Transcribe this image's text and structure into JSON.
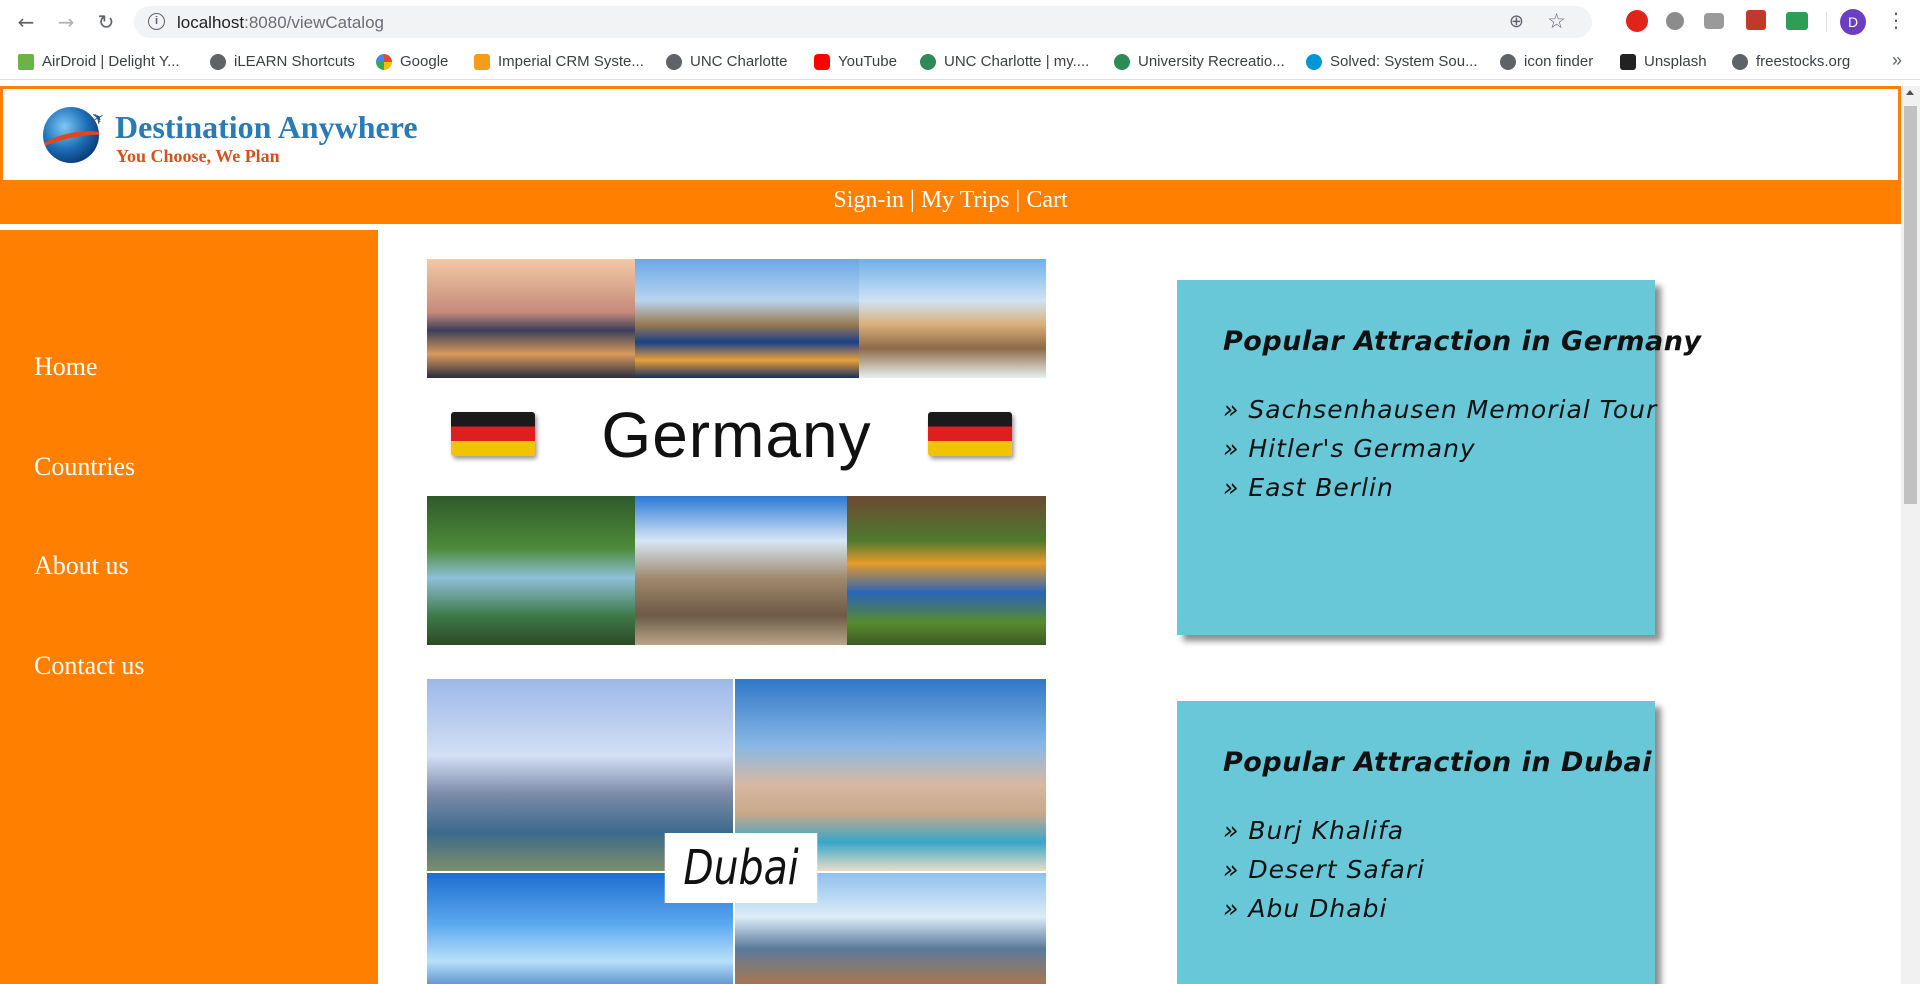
{
  "browser": {
    "url_host": "localhost",
    "url_path": ":8080/viewCatalog",
    "avatar_letter": "D",
    "bookmarks": [
      {
        "label": "AirDroid | Delight Y...",
        "icon": "airdroid-icon"
      },
      {
        "label": "iLEARN Shortcuts",
        "icon": "globe-icon"
      },
      {
        "label": "Google",
        "icon": "google-icon"
      },
      {
        "label": "Imperial CRM Syste...",
        "icon": "crm-icon"
      },
      {
        "label": "UNC Charlotte",
        "icon": "globe-icon"
      },
      {
        "label": "YouTube",
        "icon": "youtube-icon"
      },
      {
        "label": "UNC Charlotte | my....",
        "icon": "unc-icon"
      },
      {
        "label": "University Recreatio...",
        "icon": "unc-icon"
      },
      {
        "label": "Solved: System Sou...",
        "icon": "hp-icon"
      },
      {
        "label": "icon finder",
        "icon": "iconfinder-icon"
      },
      {
        "label": "Unsplash",
        "icon": "camera-icon"
      },
      {
        "label": "freestocks.org",
        "icon": "globe-icon"
      }
    ],
    "more_label": "»"
  },
  "site": {
    "title": "Destination Anywhere",
    "tagline": "You Choose, We Plan",
    "accent_color": "#ff8000"
  },
  "top_nav": {
    "signin": "Sign-in",
    "trips": "My Trips",
    "cart": "Cart",
    "sep": "|"
  },
  "sidebar": {
    "items": [
      "Home",
      "Countries",
      "About us",
      "Contact us"
    ]
  },
  "catalog": {
    "germany_label": "Germany",
    "dubai_label": "Dubai"
  },
  "cards": [
    {
      "title": "Popular Attraction in Germany",
      "items": [
        "Sachsenhausen Memorial Tour",
        "Hitler's Germany",
        "East Berlin"
      ]
    },
    {
      "title": "Popular Attraction in Dubai",
      "items": [
        "Burj Khalifa",
        "Desert Safari",
        "Abu Dhabi"
      ]
    }
  ]
}
